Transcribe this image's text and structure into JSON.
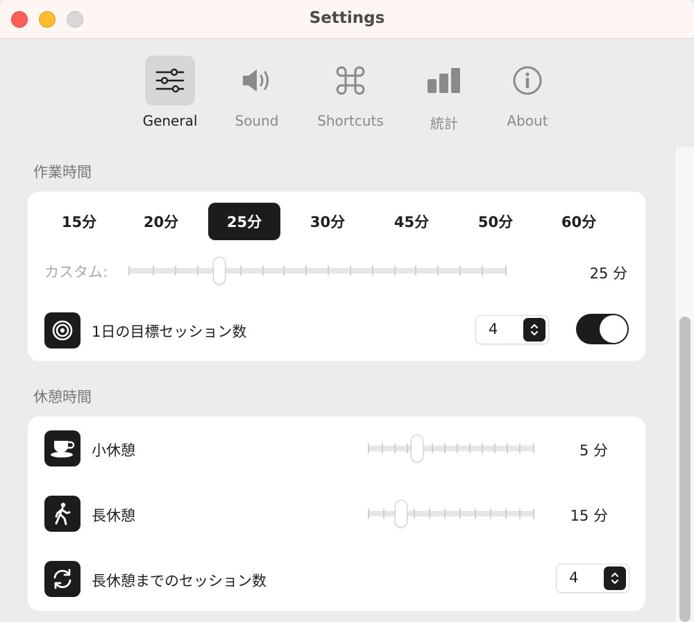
{
  "window": {
    "title": "Settings"
  },
  "toolbar": {
    "items": [
      {
        "label": "General",
        "icon": "sliders-icon",
        "active": true
      },
      {
        "label": "Sound",
        "icon": "speaker-icon",
        "active": false
      },
      {
        "label": "Shortcuts",
        "icon": "command-icon",
        "active": false
      },
      {
        "label": "統計",
        "icon": "bar-chart-icon",
        "active": false
      },
      {
        "label": "About",
        "icon": "info-icon",
        "active": false
      }
    ]
  },
  "work": {
    "section_title": "作業時間",
    "presets": [
      "15分",
      "20分",
      "25分",
      "30分",
      "45分",
      "50分",
      "60分"
    ],
    "selected_preset": "25分",
    "custom_label": "カスタム:",
    "custom_value": "25 分",
    "goal_label": "1日の目標セッション数",
    "goal_value": "4",
    "goal_enabled": true
  },
  "break": {
    "section_title": "休憩時間",
    "short_label": "小休憩",
    "short_value": "5 分",
    "long_label": "長休憩",
    "long_value": "15 分",
    "sessions_label": "長休憩までのセッション数",
    "sessions_value": "4"
  },
  "colors": {
    "accent": "#1c1c1c",
    "background": "#ececec",
    "card": "#ffffff"
  }
}
